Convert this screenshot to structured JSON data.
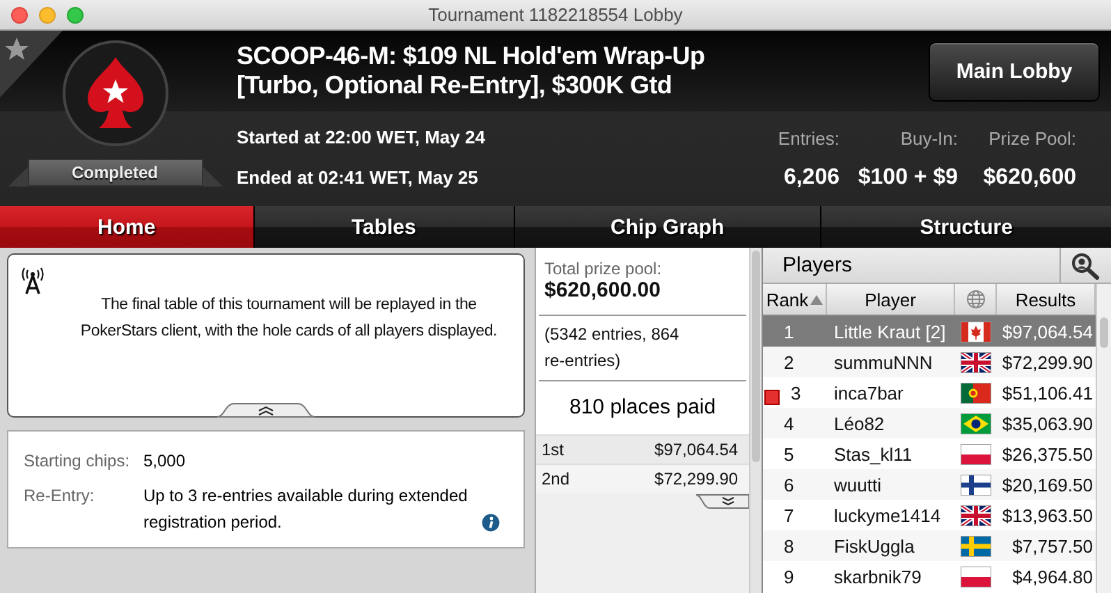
{
  "window": {
    "title": "Tournament 1182218554 Lobby"
  },
  "header": {
    "title_lines": [
      "SCOOP-46-M: $109 NL Hold'em Wrap-Up",
      "[Turbo, Optional Re-Entry], $300K Gtd"
    ],
    "status": "Completed",
    "started": "Started at 22:00 WET, May 24",
    "ended": "Ended at 02:41 WET, May 25",
    "main_lobby_button": "Main Lobby",
    "stats": [
      {
        "label": "Entries:",
        "value": "6,206"
      },
      {
        "label": "Buy-In:",
        "value": "$100 + $9"
      },
      {
        "label": "Prize Pool:",
        "value": "$620,600"
      }
    ]
  },
  "tabs": [
    {
      "label": "Home",
      "selected": true
    },
    {
      "label": "Tables",
      "selected": false
    },
    {
      "label": "Chip Graph",
      "selected": false
    },
    {
      "label": "Structure",
      "selected": false
    }
  ],
  "notice": "The final table of this tournament will be replayed in the PokerStars client, with the hole cards of all players displayed.",
  "details": [
    {
      "label": "Starting chips:",
      "value": "5,000",
      "info": false
    },
    {
      "label": "Re-Entry:",
      "value": "Up to 3 re-entries available during extended registration period.",
      "info": true
    }
  ],
  "prize_summary": {
    "total_label": "Total prize pool:",
    "total": "$620,600.00",
    "entries": "(5342 entries, 864 re-entries)",
    "places_paid": "810 places paid",
    "payouts": [
      {
        "place": "1st",
        "amount": "$97,064.54"
      },
      {
        "place": "2nd",
        "amount": "$72,299.90"
      }
    ]
  },
  "players": {
    "title": "Players",
    "columns": [
      {
        "kind": "rank",
        "label": "Rank",
        "sorted": true
      },
      {
        "kind": "player",
        "label": "Player",
        "sorted": false
      },
      {
        "kind": "globe"
      },
      {
        "kind": "results",
        "label": "Results",
        "sorted": false
      }
    ],
    "rows": [
      {
        "rank": "1",
        "name": "Little Kraut [2]",
        "kind": "ca",
        "result": "$97,064.54",
        "selected": true,
        "flagged": false
      },
      {
        "rank": "2",
        "name": "summuNNN",
        "kind": "gb",
        "result": "$72,299.90",
        "selected": false,
        "flagged": false
      },
      {
        "rank": "3",
        "name": "inca7bar",
        "kind": "pt",
        "result": "$51,106.41",
        "selected": false,
        "flagged": true
      },
      {
        "rank": "4",
        "name": "Léo82",
        "kind": "br",
        "result": "$35,063.90",
        "selected": false,
        "flagged": false
      },
      {
        "rank": "5",
        "name": "Stas_kl11",
        "kind": "pl",
        "result": "$26,375.50",
        "selected": false,
        "flagged": false
      },
      {
        "rank": "6",
        "name": "wuutti",
        "kind": "fi",
        "result": "$20,169.50",
        "selected": false,
        "flagged": false
      },
      {
        "rank": "7",
        "name": "luckyme1414",
        "kind": "gb",
        "result": "$13,963.50",
        "selected": false,
        "flagged": false
      },
      {
        "rank": "8",
        "name": "FiskUggla",
        "kind": "se",
        "result": "$7,757.50",
        "selected": false,
        "flagged": false
      },
      {
        "rank": "9",
        "name": "skarbnik79",
        "kind": "pl",
        "result": "$4,964.80",
        "selected": false,
        "flagged": false
      }
    ]
  }
}
